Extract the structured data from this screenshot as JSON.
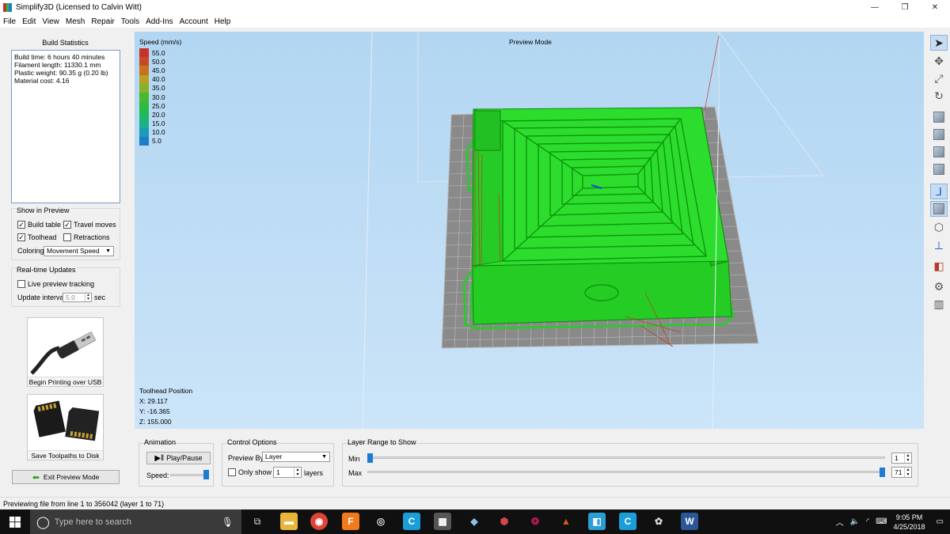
{
  "window": {
    "title": "Simplify3D (Licensed to Calvin Witt)",
    "minimize": "—",
    "restore": "❐",
    "close": "✕"
  },
  "menu": [
    "File",
    "Edit",
    "View",
    "Mesh",
    "Repair",
    "Tools",
    "Add-Ins",
    "Account",
    "Help"
  ],
  "build_statistics": {
    "title": "Build Statistics",
    "lines": [
      "Build time: 6 hours 40 minutes",
      "Filament length: 11330.1 mm",
      "Plastic weight: 90.35 g (0.20 lb)",
      "Material cost: 4.16"
    ]
  },
  "show_in_preview": {
    "title": "Show in Preview",
    "build_table": {
      "label": "Build table",
      "checked": true
    },
    "travel_moves": {
      "label": "Travel moves",
      "checked": true
    },
    "toolhead": {
      "label": "Toolhead",
      "checked": true
    },
    "retractions": {
      "label": "Retractions",
      "checked": false
    },
    "coloring_label": "Coloring",
    "coloring_value": "Movement Speed"
  },
  "realtime": {
    "title": "Real-time Updates",
    "live_preview": {
      "label": "Live preview tracking",
      "checked": false
    },
    "update_interval_label": "Update interval",
    "update_interval_value": "5.0",
    "update_interval_unit": "sec"
  },
  "tiles": {
    "usb_label": "Begin Printing over USB",
    "sd_label": "Save Toolpaths to Disk"
  },
  "exit_preview": "Exit Preview Mode",
  "viewport": {
    "legend_title": "Speed (mm/s)",
    "legend": [
      {
        "value": "55.0",
        "color": "#c8322a"
      },
      {
        "value": "50.0",
        "color": "#c84a24"
      },
      {
        "value": "45.0",
        "color": "#c8721e"
      },
      {
        "value": "40.0",
        "color": "#b8a022"
      },
      {
        "value": "35.0",
        "color": "#86b22a"
      },
      {
        "value": "30.0",
        "color": "#4ab832"
      },
      {
        "value": "25.0",
        "color": "#2ebc3a"
      },
      {
        "value": "20.0",
        "color": "#22b85a"
      },
      {
        "value": "15.0",
        "color": "#1cb08c"
      },
      {
        "value": "10.0",
        "color": "#1a9cb4"
      },
      {
        "value": "5.0",
        "color": "#1e7cc8"
      }
    ],
    "mode": "Preview Mode",
    "toolhead_title": "Toolhead Position",
    "x": "X: 29.117",
    "y": "Y: -16.365",
    "z": "Z: 155.000"
  },
  "animation": {
    "title": "Animation",
    "play_pause": "Play/Pause",
    "speed_label": "Speed:",
    "speed_level": 0.95
  },
  "control_options": {
    "title": "Control Options",
    "preview_by_label": "Preview By",
    "preview_by_value": "Layer",
    "only_show": {
      "label": "Only show",
      "checked": false
    },
    "only_show_value": "1",
    "layers_label": "layers"
  },
  "layer_range": {
    "title": "Layer Range to Show",
    "min_label": "Min",
    "max_label": "Max",
    "min_value": "1",
    "max_value": "71",
    "total_layers": 71
  },
  "status": "Previewing file from line 1 to 356042 (layer 1 to 71)",
  "taskbar": {
    "search_placeholder": "Type here to search",
    "time": "9:05 PM",
    "date": "4/25/2018"
  },
  "colors": {
    "accent": "#1d7bd4",
    "print_green": "#22cc22",
    "viewport_bg": "#b9dcf6"
  }
}
